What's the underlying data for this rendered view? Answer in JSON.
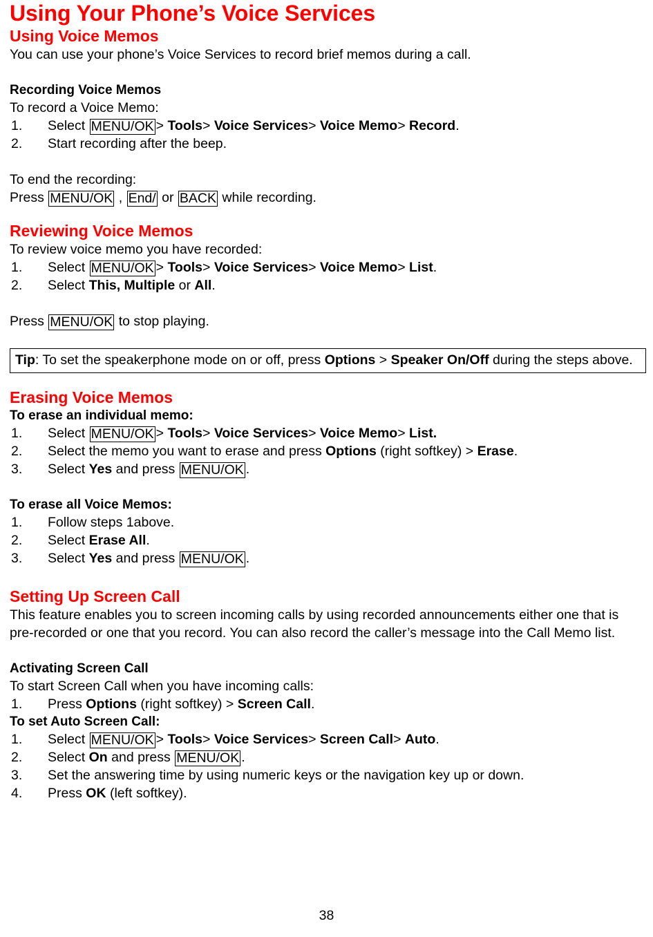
{
  "document": {
    "title": "Using Your Phone’s Voice Services",
    "page_number": "38",
    "accent_color": "#FF0000",
    "text_color": "#000000"
  },
  "sections": {
    "using_voice_memos": {
      "heading": "Using Voice Memos",
      "intro": "You can use your phone’s Voice Services to record brief memos during a call."
    },
    "recording": {
      "heading": "Recording Voice Memos",
      "lead": "To record a Voice Memo:",
      "step1": {
        "num": "1.",
        "a": "Select",
        "key": "MENU/OK",
        "sep1": ">",
        "b1": "Tools",
        "sep2": ">",
        "b2": "Voice Services",
        "sep3": ">",
        "b3": "Voice Memo",
        "sep4": ">",
        "b4": "Record",
        "end": "."
      },
      "step2": {
        "num": "2.",
        "text": "Start recording after the beep."
      },
      "end_lead": "To end the recording:",
      "end_line": {
        "a": "Press",
        "key1": "MENU/OK",
        "comma": ",",
        "key2": "End/",
        "or": "or",
        "key3": "BACK",
        "tail": "while recording."
      }
    },
    "reviewing": {
      "heading": "Reviewing Voice Memos",
      "lead": "To review voice memo you have recorded:",
      "step1": {
        "num": "1.",
        "a": "Select",
        "key": "MENU/OK",
        "sep1": ">",
        "b1": "Tools",
        "sep2": ">",
        "b2": "Voice Services",
        "sep3": ">",
        "b3": "Voice Memo",
        "sep4": ">",
        "b4": "List",
        "end": "."
      },
      "step2": {
        "num": "2.",
        "a": "Select",
        "b1": "This, Multiple",
        "or": "or",
        "b2": "All",
        "end": "."
      },
      "stop_line": {
        "a": "Press",
        "key": "MENU/OK",
        "tail": "to stop playing."
      }
    },
    "tip": {
      "label": "Tip",
      "a": ": To set the speakerphone mode on or off, press",
      "b1": "Options",
      "sep": ">",
      "b2": "Speaker On/Off",
      "tail": "during the steps above."
    },
    "erasing": {
      "heading": "Erasing Voice Memos",
      "individual_lead": "To erase an individual memo:",
      "ind_step1": {
        "num": "1.",
        "a": "Select",
        "key": "MENU/OK",
        "sep1": ">",
        "b1": "Tools",
        "sep2": ">",
        "b2": "Voice Services",
        "sep3": ">",
        "b3": "Voice Memo",
        "sep4": ">",
        "b4": "List."
      },
      "ind_step2": {
        "num": "2.",
        "a": "Select the memo you want to erase and press",
        "b1": "Options",
        "mid": "(right softkey) >",
        "b2": "Erase",
        "end": "."
      },
      "ind_step3": {
        "num": "3.",
        "a": "Select",
        "b1": "Yes",
        "mid": "and press",
        "key": "MENU/OK",
        "end": "."
      },
      "all_lead": "To erase all Voice Memos:",
      "all_step1": {
        "num": "1.",
        "text": "Follow steps 1above."
      },
      "all_step2": {
        "num": "2.",
        "a": "Select",
        "b1": "Erase All",
        "end": "."
      },
      "all_step3": {
        "num": "3.",
        "a": "Select",
        "b1": "Yes",
        "mid": "and press",
        "key": "MENU/OK",
        "end": "."
      }
    },
    "screen_call": {
      "heading": "Setting Up Screen Call",
      "intro": "This feature enables you to screen incoming calls by using recorded announcements either one that is pre-recorded or one that you record. You can also record the caller’s message into the Call Memo list."
    },
    "activating": {
      "heading": "Activating Screen Call",
      "lead": "To start Screen Call when you have incoming calls:",
      "step1": {
        "num": "1.",
        "a": "Press",
        "b1": "Options",
        "mid": "(right softkey) >",
        "b2": "Screen Call",
        "end": "."
      },
      "auto_lead": "To set Auto Screen Call:",
      "auto_step1": {
        "num": "1.",
        "a": "Select",
        "key": "MENU/OK",
        "sep1": ">",
        "b1": "Tools",
        "sep2": ">",
        "b2": "Voice Services",
        "sep3": ">",
        "b3": "Screen Call",
        "sep4": ">",
        "b4": "Auto",
        "end": "."
      },
      "auto_step2": {
        "num": "2.",
        "a": "Select",
        "b1": "On",
        "mid": "and press",
        "key": "MENU/OK",
        "end": "."
      },
      "auto_step3": {
        "num": "3.",
        "text": "Set the answering time by using numeric keys or the navigation key up or down."
      },
      "auto_step4": {
        "num": "4.",
        "a": "Press",
        "b1": "OK",
        "mid": "(left softkey).",
        "end": ""
      }
    }
  }
}
